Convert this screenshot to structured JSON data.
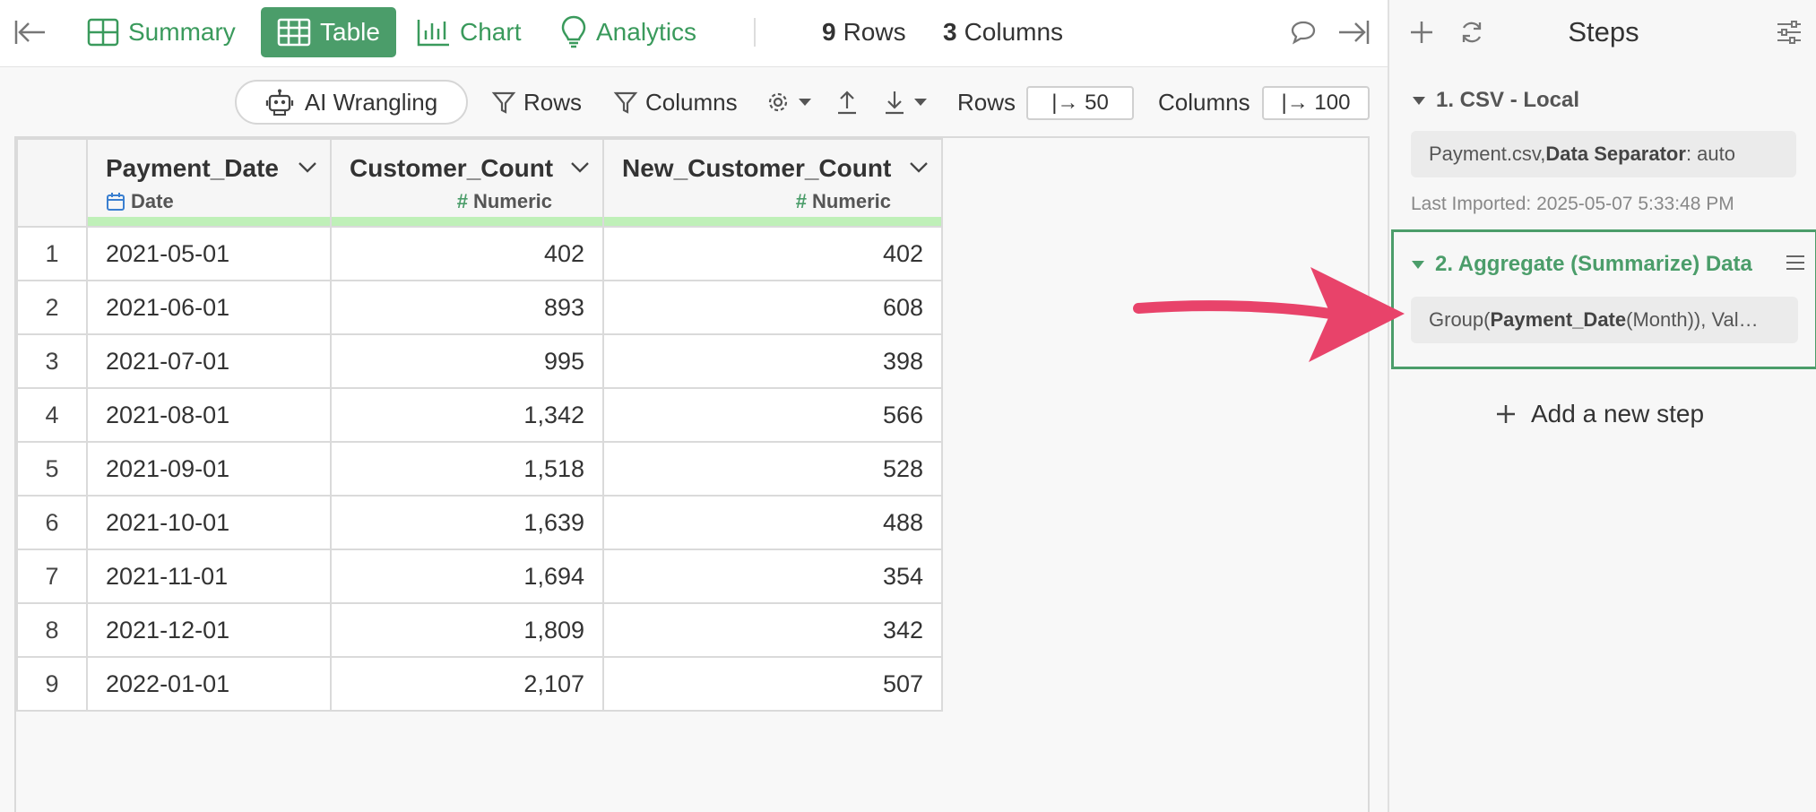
{
  "topbar": {
    "tabs": [
      {
        "label": "Summary"
      },
      {
        "label": "Table"
      },
      {
        "label": "Chart"
      },
      {
        "label": "Analytics"
      }
    ],
    "rows_count": "9",
    "rows_label": "Rows",
    "cols_count": "3",
    "cols_label": "Columns"
  },
  "toolbar": {
    "ai_label": "AI Wrangling",
    "rows_filter": "Rows",
    "columns_filter": "Columns",
    "rows_label": "Rows",
    "rows_value": "|→ 50",
    "columns_label": "Columns",
    "columns_value": "|→ 100"
  },
  "table": {
    "columns": [
      {
        "name": "Payment_Date",
        "type": "Date"
      },
      {
        "name": "Customer_Count",
        "type": "Numeric"
      },
      {
        "name": "New_Customer_Count",
        "type": "Numeric"
      }
    ],
    "rows": [
      [
        "1",
        "2021-05-01",
        "402",
        "402"
      ],
      [
        "2",
        "2021-06-01",
        "893",
        "608"
      ],
      [
        "3",
        "2021-07-01",
        "995",
        "398"
      ],
      [
        "4",
        "2021-08-01",
        "1,342",
        "566"
      ],
      [
        "5",
        "2021-09-01",
        "1,518",
        "528"
      ],
      [
        "6",
        "2021-10-01",
        "1,639",
        "488"
      ],
      [
        "7",
        "2021-11-01",
        "1,694",
        "354"
      ],
      [
        "8",
        "2021-12-01",
        "1,809",
        "342"
      ],
      [
        "9",
        "2022-01-01",
        "2,107",
        "507"
      ]
    ]
  },
  "steps": {
    "title": "Steps",
    "step1": {
      "title": "1. CSV - Local",
      "file": "Payment.csv, ",
      "param_key": "Data Separator",
      "param_val": ": auto",
      "imported": "Last Imported: 2025-05-07 5:33:48 PM"
    },
    "step2": {
      "title": "2. Aggregate (Summarize) Data",
      "pre": "Group(",
      "key": "Payment_Date",
      "post": " (Month)), Val…"
    },
    "add_label": "Add a new step"
  },
  "colors": {
    "accent": "#4b9d6a",
    "arrow": "#e8436a",
    "header_bar": "#bff0b8"
  }
}
